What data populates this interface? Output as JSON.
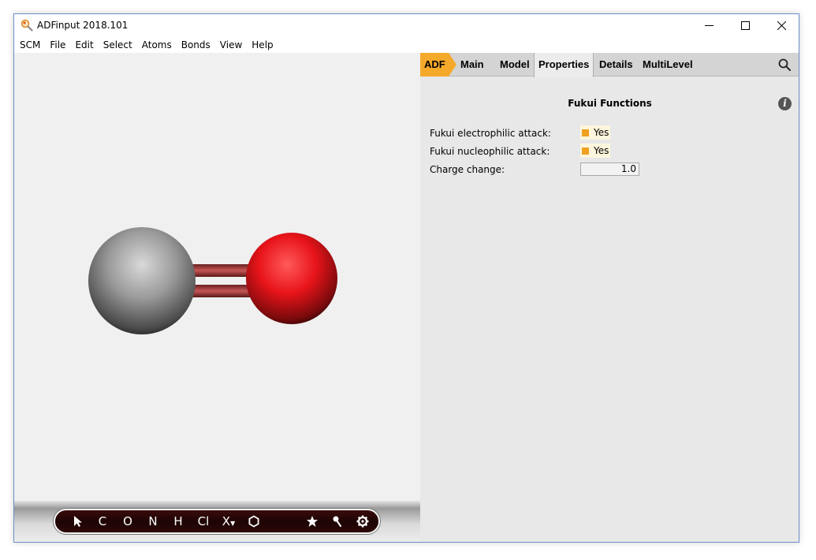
{
  "window": {
    "title": "ADFinput 2018.101",
    "controls": {
      "minimize": "minimize-icon",
      "maximize": "maximize-icon",
      "close": "close-icon"
    }
  },
  "menu": [
    "SCM",
    "File",
    "Edit",
    "Select",
    "Atoms",
    "Bonds",
    "View",
    "Help"
  ],
  "viewport": {
    "molecule": {
      "atoms": [
        "C",
        "O"
      ],
      "bond": "double",
      "colors": {
        "carbon": "#8c8c8c",
        "oxygen": "#e0141a",
        "bond": "#b54545"
      }
    },
    "toolbar": {
      "tools": [
        "C",
        "O",
        "N",
        "H",
        "Cl",
        "X"
      ],
      "icons": [
        "select-arrow-icon",
        "ring-hexagon-icon",
        "star-icon",
        "pin-icon",
        "gear-icon"
      ]
    }
  },
  "panel": {
    "tabs": {
      "adf": "ADF",
      "main": "Main",
      "model": "Model",
      "properties": "Properties",
      "details": "Details",
      "multilevel": "MultiLevel",
      "active": "Properties"
    },
    "section_title": "Fukui Functions",
    "fields": {
      "electrophilic_label": "Fukui electrophilic attack:",
      "electrophilic_value": "Yes",
      "nucleophilic_label": "Fukui nucleophilic attack:",
      "nucleophilic_value": "Yes",
      "charge_label": "Charge change:",
      "charge_value": "1.0"
    },
    "accent_color": "#f5a92b"
  }
}
